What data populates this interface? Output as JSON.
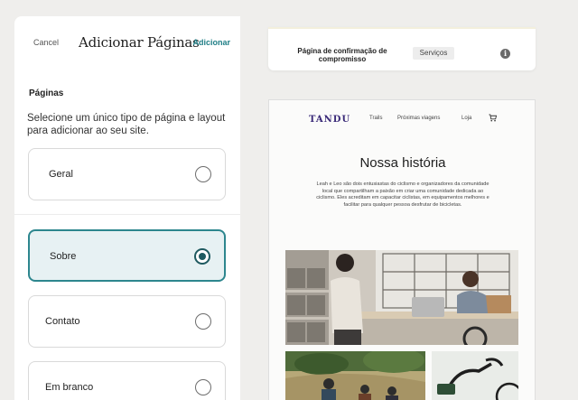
{
  "panel": {
    "cancel_label": "Cancel",
    "title": "Adicionar Páginas",
    "add_label": "Adicionar",
    "section_label": "Páginas",
    "description": "Selecione um único tipo de página e layout para adicionar ao seu site.",
    "options": [
      {
        "label": "Geral",
        "selected": false
      },
      {
        "label": "Sobre",
        "selected": true
      },
      {
        "label": "Contato",
        "selected": false
      },
      {
        "label": "Em branco",
        "selected": false
      }
    ]
  },
  "preview": {
    "confirmation_card": {
      "title": "Página de confirmação de compromisso",
      "chip": "Serviços",
      "info_icon": "info-icon"
    },
    "site": {
      "logo": "TANDU",
      "nav": [
        "Trails",
        "Próximas viagens",
        "Loja"
      ],
      "cart_icon": "cart-icon",
      "heading": "Nossa história",
      "paragraph": "Leah e Leo são dois entusiastas do ciclismo e organizadores da comunidade local que compartilham a paixão em criar uma comunidade dedicada ao ciclismo. Eles acreditam em capacitar ciclistas, em equipamentos melhores e facilitar para qualquer pessoa desfrutar de bicicletas."
    }
  },
  "colors": {
    "accent": "#1f7e86",
    "selected_bg": "#e7f1f3",
    "selected_border": "#2d868e",
    "logo": "#3a2a78"
  }
}
